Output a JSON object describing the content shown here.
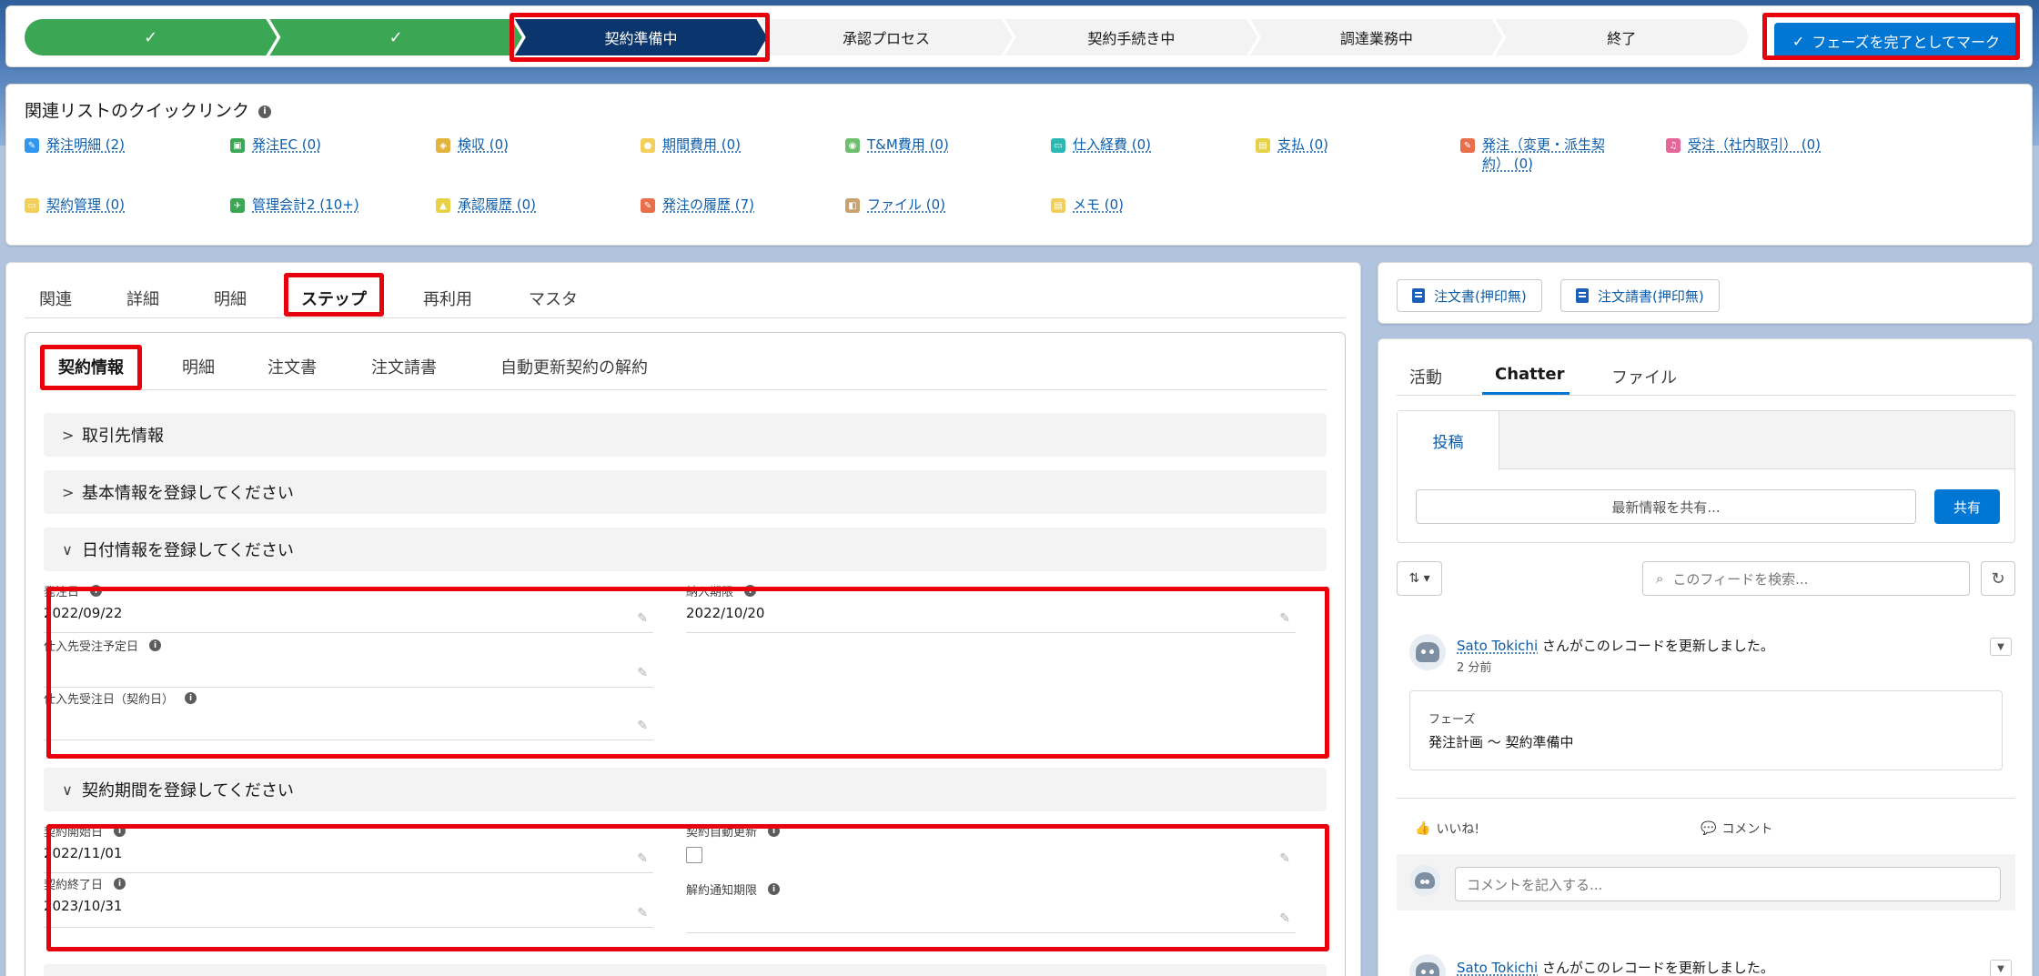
{
  "path": {
    "steps": [
      {
        "label": "✓",
        "state": "done"
      },
      {
        "label": "✓",
        "state": "done"
      },
      {
        "label": "契約準備中",
        "state": "current"
      },
      {
        "label": "承認プロセス",
        "state": "todo"
      },
      {
        "label": "契約手続き中",
        "state": "todo"
      },
      {
        "label": "調達業務中",
        "state": "todo"
      },
      {
        "label": "終了",
        "state": "todo"
      }
    ],
    "mark_button": "フェーズを完了としてマーク"
  },
  "quick_links": {
    "title": "関連リストのクイックリンク",
    "items": [
      {
        "label": "発注明細 (2)",
        "color": "#3296ed"
      },
      {
        "label": "発注EC (0)",
        "color": "#3ba755"
      },
      {
        "label": "検収 (0)",
        "color": "#e3b33f"
      },
      {
        "label": "期間費用 (0)",
        "color": "#f2cf5b"
      },
      {
        "label": "T&M費用 (0)",
        "color": "#6ec06e"
      },
      {
        "label": "仕入経費 (0)",
        "color": "#2eb8b5"
      },
      {
        "label": "支払 (0)",
        "color": "#e8d047"
      },
      {
        "label": "発注（変更・派生契約） (0)",
        "color": "#e96e4c"
      },
      {
        "label": "受注（社内取引） (0)",
        "color": "#e56798"
      },
      {
        "label": "契約管理 (0)",
        "color": "#f2cf5b"
      },
      {
        "label": "管理会計2 (10+)",
        "color": "#3ba755"
      },
      {
        "label": "承認履歴 (0)",
        "color": "#e8d047"
      },
      {
        "label": "発注の履歴 (7)",
        "color": "#e96e4c"
      },
      {
        "label": "ファイル (0)",
        "color": "#c9a36f"
      },
      {
        "label": "メモ (0)",
        "color": "#f2cf5b"
      }
    ]
  },
  "main_tabs": [
    "関連",
    "詳細",
    "明細",
    "ステップ",
    "再利用",
    "マスタ"
  ],
  "sub_tabs": [
    "契約情報",
    "明細",
    "注文書",
    "注文請書",
    "自動更新契約の解約"
  ],
  "sections": {
    "s1": "取引先情報",
    "s2": "基本情報を登録してください",
    "s3": "日付情報を登録してください",
    "s4": "契約期間を登録してください"
  },
  "fields": {
    "order_date": {
      "label": "発注日",
      "value": "2022/09/22"
    },
    "delivery_deadline": {
      "label": "納入期限",
      "value": "2022/10/20"
    },
    "supplier_planned": {
      "label": "仕入先受注予定日",
      "value": ""
    },
    "supplier_date": {
      "label": "仕入先受注日（契約日）",
      "value": ""
    },
    "contract_start": {
      "label": "契約開始日",
      "value": "2022/11/01"
    },
    "auto_renew": {
      "label": "契約自動更新",
      "value": ""
    },
    "contract_end": {
      "label": "契約終了日",
      "value": "2023/10/31"
    },
    "cancel_notice": {
      "label": "解約通知期限",
      "value": ""
    }
  },
  "right": {
    "btn1": "注文書(押印無)",
    "btn2": "注文請書(押印無)",
    "feed_tabs": [
      "活動",
      "Chatter",
      "ファイル"
    ],
    "publisher_tab": "投稿",
    "publisher_placeholder": "最新情報を共有...",
    "share": "共有",
    "sort": "⇅ ▾",
    "search_placeholder": "このフィードを検索...",
    "post1": {
      "author": "Sato Tokichi",
      "text": " さんがこのレコードを更新しました。",
      "time": "2 分前",
      "change_label": "フェーズ",
      "change_value": "発注計画 〜 契約準備中"
    },
    "like": "いいね!",
    "comment": "コメント",
    "comment_placeholder": "コメントを記入する...",
    "post2": {
      "author": "Sato Tokichi",
      "text": " さんがこのレコードを更新しました。"
    }
  }
}
